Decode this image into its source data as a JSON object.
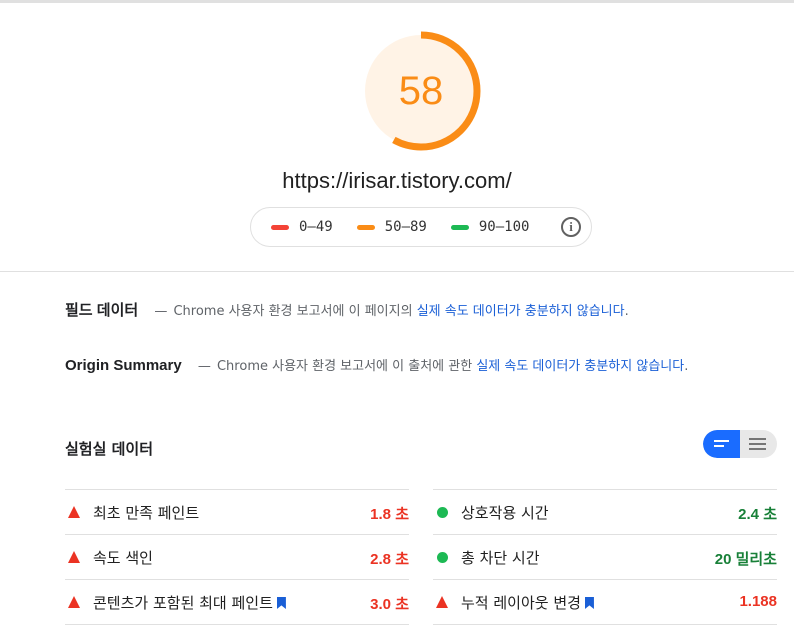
{
  "score": {
    "value": "58",
    "progress": 0.58,
    "color": "#fa8c16",
    "bg_color": "#fff3e6"
  },
  "url": "https://irisar.tistory.com/",
  "legend": {
    "items": [
      {
        "range": "0–49",
        "color": "#f44336"
      },
      {
        "range": "50–89",
        "color": "#fa8c16"
      },
      {
        "range": "90–100",
        "color": "#1db954"
      }
    ],
    "info_icon": "info-icon"
  },
  "field_data": {
    "title": "필드 데이터",
    "dash": "—",
    "text": "Chrome 사용자 환경 보고서에 이 페이지의",
    "link": "실제 속도 데이터가 충분하지 않습니다",
    "end": "."
  },
  "origin_summary": {
    "title": "Origin Summary",
    "dash": "—",
    "text": "Chrome 사용자 환경 보고서에 이 출처에 관한",
    "link": "실제 속도 데이터가 충분하지 않습니다",
    "end": "."
  },
  "lab_data": {
    "title": "실험실 데이터",
    "view_toggle": {
      "selected": "opportunity-view",
      "icons": [
        "list-compact-icon",
        "list-expanded-icon"
      ]
    }
  },
  "metrics_left": [
    {
      "label": "최초 만족 페인트",
      "value": "1.8 초",
      "status": "fail",
      "bookmark": false
    },
    {
      "label": "속도 색인",
      "value": "2.8 초",
      "status": "fail",
      "bookmark": false
    },
    {
      "label": "콘텐츠가 포함된 최대 페인트",
      "value": "3.0 초",
      "status": "fail",
      "bookmark": true
    }
  ],
  "metrics_right": [
    {
      "label": "상호작용 시간",
      "value": "2.4 초",
      "status": "pass",
      "bookmark": false
    },
    {
      "label": "총 차단 시간",
      "value": "20 밀리초",
      "status": "pass",
      "bookmark": false
    },
    {
      "label": "누적 레이아웃 변경",
      "value": "1.188",
      "status": "fail",
      "bookmark": true
    }
  ],
  "colors": {
    "fail": "#eb3323",
    "pass": "#188038",
    "link": "#1a5fd6"
  }
}
